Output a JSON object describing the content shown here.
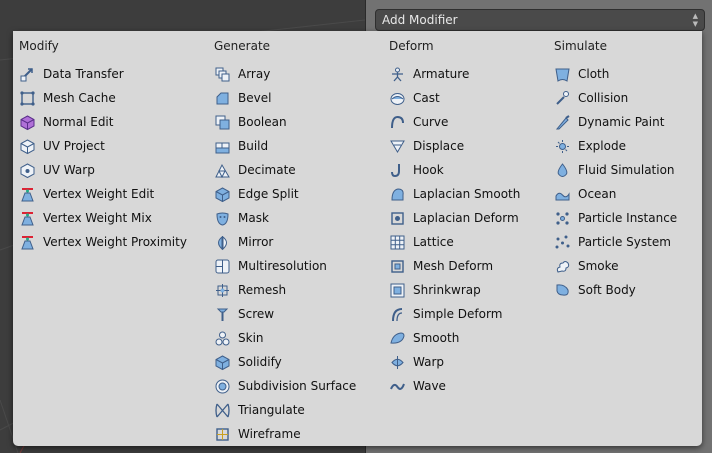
{
  "header": {
    "add_modifier_label": "Add Modifier",
    "dropdown_arrows": "▲▼"
  },
  "colors": {
    "menu_bg": "#d8d8d8",
    "viewport_bg": "#3d3d3d",
    "icon_blue": "#3f5f8a",
    "icon_light": "#eef2f7"
  },
  "menu": {
    "columns": [
      {
        "title": "Modify",
        "items": [
          {
            "label": "Data Transfer",
            "icon": "data-transfer-icon"
          },
          {
            "label": "Mesh Cache",
            "icon": "mesh-cache-icon"
          },
          {
            "label": "Normal Edit",
            "icon": "normal-edit-icon"
          },
          {
            "label": "UV Project",
            "icon": "uv-project-icon"
          },
          {
            "label": "UV Warp",
            "icon": "uv-warp-icon"
          },
          {
            "label": "Vertex Weight Edit",
            "icon": "vertex-weight-edit-icon"
          },
          {
            "label": "Vertex Weight Mix",
            "icon": "vertex-weight-mix-icon"
          },
          {
            "label": "Vertex Weight Proximity",
            "icon": "vertex-weight-proximity-icon"
          }
        ]
      },
      {
        "title": "Generate",
        "items": [
          {
            "label": "Array",
            "icon": "array-icon"
          },
          {
            "label": "Bevel",
            "icon": "bevel-icon"
          },
          {
            "label": "Boolean",
            "icon": "boolean-icon"
          },
          {
            "label": "Build",
            "icon": "build-icon"
          },
          {
            "label": "Decimate",
            "icon": "decimate-icon"
          },
          {
            "label": "Edge Split",
            "icon": "edge-split-icon"
          },
          {
            "label": "Mask",
            "icon": "mask-icon"
          },
          {
            "label": "Mirror",
            "icon": "mirror-icon"
          },
          {
            "label": "Multiresolution",
            "icon": "multiresolution-icon"
          },
          {
            "label": "Remesh",
            "icon": "remesh-icon"
          },
          {
            "label": "Screw",
            "icon": "screw-icon"
          },
          {
            "label": "Skin",
            "icon": "skin-icon"
          },
          {
            "label": "Solidify",
            "icon": "solidify-icon"
          },
          {
            "label": "Subdivision Surface",
            "icon": "subdivision-surface-icon"
          },
          {
            "label": "Triangulate",
            "icon": "triangulate-icon"
          },
          {
            "label": "Wireframe",
            "icon": "wireframe-icon"
          }
        ]
      },
      {
        "title": "Deform",
        "items": [
          {
            "label": "Armature",
            "icon": "armature-icon"
          },
          {
            "label": "Cast",
            "icon": "cast-icon"
          },
          {
            "label": "Curve",
            "icon": "curve-icon"
          },
          {
            "label": "Displace",
            "icon": "displace-icon"
          },
          {
            "label": "Hook",
            "icon": "hook-icon"
          },
          {
            "label": "Laplacian Smooth",
            "icon": "laplacian-smooth-icon"
          },
          {
            "label": "Laplacian Deform",
            "icon": "laplacian-deform-icon"
          },
          {
            "label": "Lattice",
            "icon": "lattice-icon"
          },
          {
            "label": "Mesh Deform",
            "icon": "mesh-deform-icon"
          },
          {
            "label": "Shrinkwrap",
            "icon": "shrinkwrap-icon"
          },
          {
            "label": "Simple Deform",
            "icon": "simple-deform-icon"
          },
          {
            "label": "Smooth",
            "icon": "smooth-icon"
          },
          {
            "label": "Warp",
            "icon": "warp-icon"
          },
          {
            "label": "Wave",
            "icon": "wave-icon"
          }
        ]
      },
      {
        "title": "Simulate",
        "items": [
          {
            "label": "Cloth",
            "icon": "cloth-icon"
          },
          {
            "label": "Collision",
            "icon": "collision-icon"
          },
          {
            "label": "Dynamic Paint",
            "icon": "dynamic-paint-icon"
          },
          {
            "label": "Explode",
            "icon": "explode-icon"
          },
          {
            "label": "Fluid Simulation",
            "icon": "fluid-simulation-icon"
          },
          {
            "label": "Ocean",
            "icon": "ocean-icon"
          },
          {
            "label": "Particle Instance",
            "icon": "particle-instance-icon"
          },
          {
            "label": "Particle System",
            "icon": "particle-system-icon"
          },
          {
            "label": "Smoke",
            "icon": "smoke-icon"
          },
          {
            "label": "Soft Body",
            "icon": "soft-body-icon"
          }
        ]
      }
    ]
  }
}
